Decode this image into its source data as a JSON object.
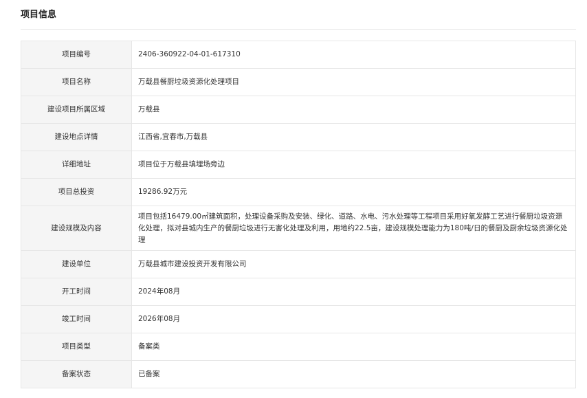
{
  "section": {
    "title": "项目信息"
  },
  "rows": [
    {
      "label": "项目编号",
      "value": "2406-360922-04-01-617310"
    },
    {
      "label": "项目名称",
      "value": "万载县餐厨垃圾资源化处理项目"
    },
    {
      "label": "建设项目所属区域",
      "value": "万载县"
    },
    {
      "label": "建设地点详情",
      "value": "江西省,宜春市,万载县"
    },
    {
      "label": "详细地址",
      "value": "项目位于万载县填埋场旁边"
    },
    {
      "label": "项目总投资",
      "value": "19286.92万元"
    },
    {
      "label": "建设规模及内容",
      "value": "项目包括16479.00㎡建筑面积，处理设备采购及安装、绿化、道路、水电、污水处理等工程项目采用好氧发酵工艺进行餐厨垃圾资源化处理，拟对县城内生产的餐厨垃圾进行无害化处理及利用，用地约22.5亩，建设规模处理能力为180吨/日的餐厨及厨余垃圾资源化处理"
    },
    {
      "label": "建设单位",
      "value": "万载县城市建设投资开发有限公司"
    },
    {
      "label": "开工时间",
      "value": "2024年08月"
    },
    {
      "label": "竣工时间",
      "value": "2026年08月"
    },
    {
      "label": "项目类型",
      "value": "备案类"
    },
    {
      "label": "备案状态",
      "value": "已备案"
    }
  ]
}
